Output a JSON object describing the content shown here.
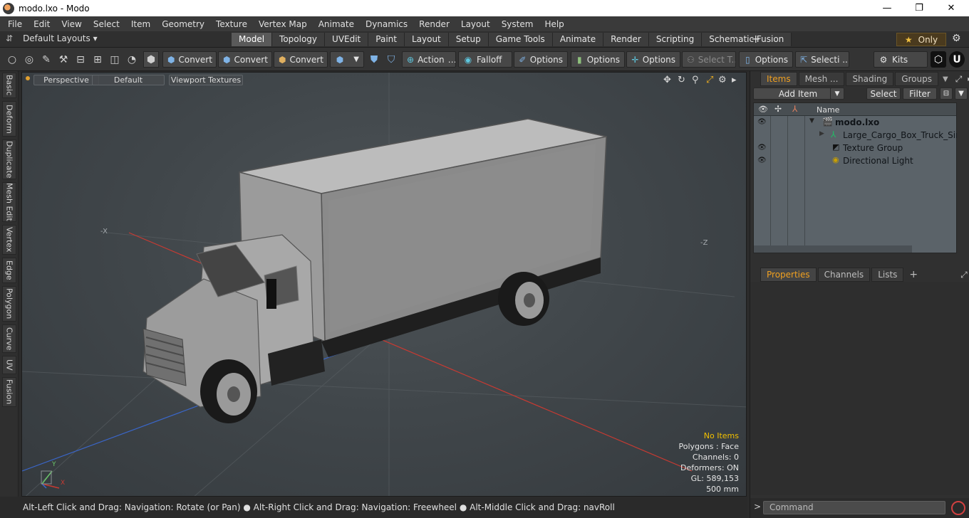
{
  "window": {
    "title": "modo.lxo - Modo",
    "controls": [
      "—",
      "❐",
      "✕"
    ]
  },
  "menu": [
    "File",
    "Edit",
    "View",
    "Select",
    "Item",
    "Geometry",
    "Texture",
    "Vertex Map",
    "Animate",
    "Dynamics",
    "Render",
    "Layout",
    "System",
    "Help"
  ],
  "layouts": {
    "label": "Default Layouts ▾"
  },
  "tabs": [
    {
      "label": "Model",
      "active": true
    },
    {
      "label": "Topology"
    },
    {
      "label": "UVEdit"
    },
    {
      "label": "Paint"
    },
    {
      "label": "Layout"
    },
    {
      "label": "Setup"
    },
    {
      "label": "Game Tools"
    },
    {
      "label": "Animate"
    },
    {
      "label": "Render"
    },
    {
      "label": "Scripting"
    },
    {
      "label": "Schematic Fusion"
    }
  ],
  "tabbar": {
    "plus": "+",
    "only_label": "Only",
    "star": "★",
    "gear": "⚙"
  },
  "toolbar": {
    "convert1": "Convert",
    "convert2": "Convert",
    "convert3": "Convert",
    "action": "Action",
    "falloff": "Falloff",
    "options1": "Options",
    "options2": "Options",
    "options3": "Options",
    "select_t": "Select T...",
    "options4": "Options",
    "selecti": "Selecti ...",
    "kits": "Kits"
  },
  "left_tabs": [
    "Basic",
    "Deform",
    "Duplicate",
    "Mesh Edit",
    "Vertex",
    "Edge",
    "Polygon",
    "Curve",
    "UV",
    "Fusion"
  ],
  "viewport": {
    "mode": "Perspective",
    "shading": "Default",
    "textures": "Viewport Textures",
    "axis_labels": {
      "neg_x": "-X",
      "neg_z": "-Z",
      "y": "Y",
      "x": "X"
    },
    "stats": {
      "selection": "No Items",
      "polygons": "Polygons : Face",
      "channels": "Channels: 0",
      "deformers": "Deformers: ON",
      "gl": "GL: 589,153",
      "scale": "500 mm"
    }
  },
  "statusbar": {
    "hint": "Alt-Left Click and Drag: Navigation: Rotate (or Pan) ● Alt-Right Click and Drag: Navigation: Freewheel ● Alt-Middle Click and Drag: navRoll"
  },
  "items_panel": {
    "tabs": [
      "Items",
      "Mesh ...",
      "Shading",
      "Groups"
    ],
    "add_item": "Add Item",
    "select": "Select",
    "filter": "Filter",
    "name_header": "Name",
    "rows": [
      {
        "label": "modo.lxo",
        "visible": true,
        "bold": true
      },
      {
        "label": "Large_Cargo_Box_Truck_Simp...",
        "visible": false
      },
      {
        "label": "Texture Group",
        "visible": true
      },
      {
        "label": "Directional Light",
        "visible": true
      }
    ]
  },
  "properties_panel": {
    "tabs": [
      "Properties",
      "Channels",
      "Lists"
    ],
    "plus": "+"
  },
  "command": {
    "prompt": ">",
    "placeholder": "Command"
  },
  "colors": {
    "accent": "#f0a020",
    "stats_highlight": "#f2c000",
    "x_axis": "#c83a32",
    "z_axis": "#3a66c8"
  }
}
